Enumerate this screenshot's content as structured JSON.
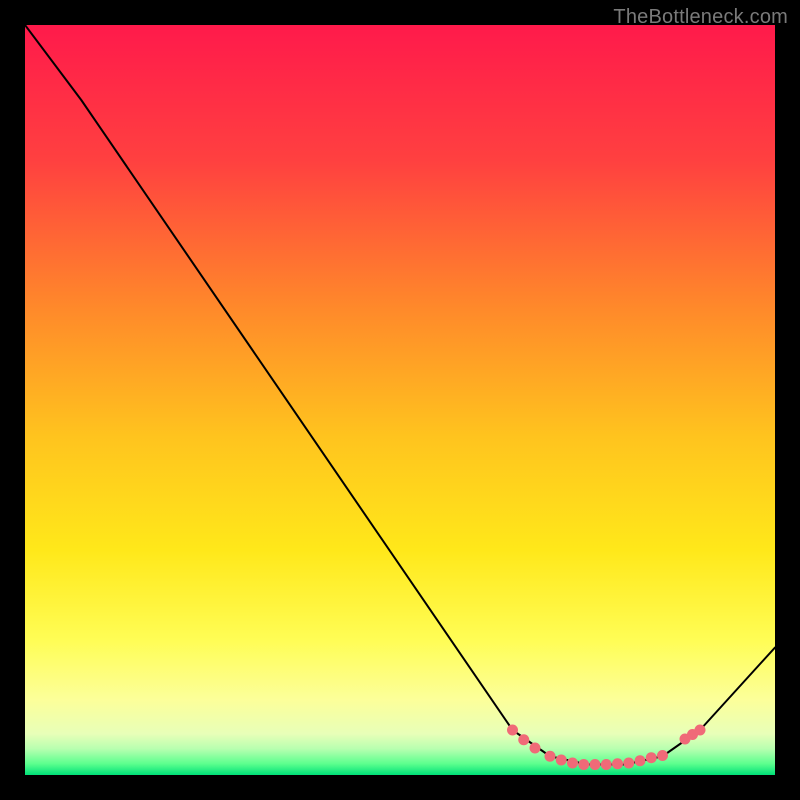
{
  "watermark": "TheBottleneck.com",
  "chart_data": {
    "type": "line",
    "title": "",
    "xlabel": "",
    "ylabel": "",
    "xlim": [
      0,
      100
    ],
    "ylim": [
      0,
      100
    ],
    "grid": false,
    "legend": false,
    "background_gradient_stops": [
      {
        "offset": 0.0,
        "color": "#ff1a4b"
      },
      {
        "offset": 0.18,
        "color": "#ff4040"
      },
      {
        "offset": 0.38,
        "color": "#ff8a2a"
      },
      {
        "offset": 0.55,
        "color": "#ffc41e"
      },
      {
        "offset": 0.7,
        "color": "#ffe81a"
      },
      {
        "offset": 0.82,
        "color": "#fffd55"
      },
      {
        "offset": 0.9,
        "color": "#fcff9a"
      },
      {
        "offset": 0.945,
        "color": "#e8ffb8"
      },
      {
        "offset": 0.965,
        "color": "#b8ffb0"
      },
      {
        "offset": 0.985,
        "color": "#5cff8e"
      },
      {
        "offset": 1.0,
        "color": "#00e078"
      }
    ],
    "series": [
      {
        "name": "curve",
        "stroke": "#000000",
        "stroke_width": 2,
        "points": [
          {
            "x": 0.0,
            "y": 100.0
          },
          {
            "x": 7.5,
            "y": 90.0
          },
          {
            "x": 65.0,
            "y": 6.0
          },
          {
            "x": 70.0,
            "y": 2.5
          },
          {
            "x": 75.0,
            "y": 1.4
          },
          {
            "x": 80.0,
            "y": 1.4
          },
          {
            "x": 85.0,
            "y": 2.5
          },
          {
            "x": 90.0,
            "y": 6.0
          },
          {
            "x": 100.0,
            "y": 17.0
          }
        ]
      }
    ],
    "markers": {
      "name": "highlight-dots",
      "fill": "#f06a78",
      "radius": 5.5,
      "points": [
        {
          "x": 65.0,
          "y": 6.0
        },
        {
          "x": 66.5,
          "y": 4.7
        },
        {
          "x": 68.0,
          "y": 3.6
        },
        {
          "x": 70.0,
          "y": 2.5
        },
        {
          "x": 71.5,
          "y": 2.0
        },
        {
          "x": 73.0,
          "y": 1.6
        },
        {
          "x": 74.5,
          "y": 1.4
        },
        {
          "x": 76.0,
          "y": 1.4
        },
        {
          "x": 77.5,
          "y": 1.4
        },
        {
          "x": 79.0,
          "y": 1.5
        },
        {
          "x": 80.5,
          "y": 1.6
        },
        {
          "x": 82.0,
          "y": 1.9
        },
        {
          "x": 83.5,
          "y": 2.3
        },
        {
          "x": 85.0,
          "y": 2.6
        },
        {
          "x": 88.0,
          "y": 4.8
        },
        {
          "x": 89.0,
          "y": 5.4
        },
        {
          "x": 90.0,
          "y": 6.0
        }
      ]
    }
  }
}
